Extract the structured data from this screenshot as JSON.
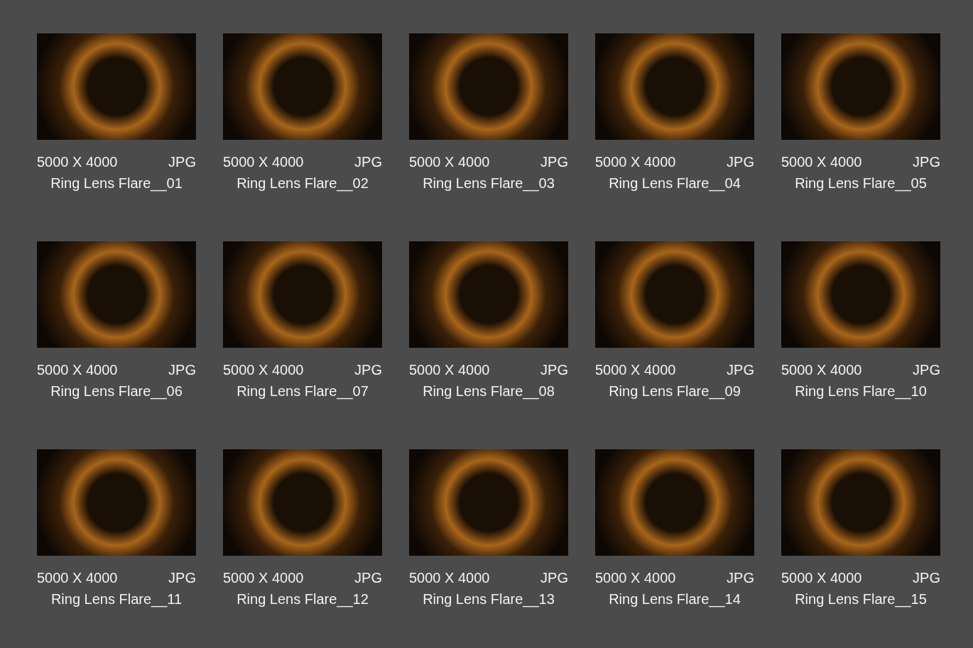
{
  "items": [
    {
      "size": "5000 X 4000",
      "format": "JPG",
      "name": "Ring Lens Flare__01"
    },
    {
      "size": "5000 X 4000",
      "format": "JPG",
      "name": "Ring Lens Flare__02"
    },
    {
      "size": "5000 X 4000",
      "format": "JPG",
      "name": "Ring Lens Flare__03"
    },
    {
      "size": "5000 X 4000",
      "format": "JPG",
      "name": "Ring Lens Flare__04"
    },
    {
      "size": "5000 X 4000",
      "format": "JPG",
      "name": "Ring Lens Flare__05"
    },
    {
      "size": "5000 X 4000",
      "format": "JPG",
      "name": "Ring Lens Flare__06"
    },
    {
      "size": "5000 X 4000",
      "format": "JPG",
      "name": "Ring Lens Flare__07"
    },
    {
      "size": "5000 X 4000",
      "format": "JPG",
      "name": "Ring Lens Flare__08"
    },
    {
      "size": "5000 X 4000",
      "format": "JPG",
      "name": "Ring Lens Flare__09"
    },
    {
      "size": "5000 X 4000",
      "format": "JPG",
      "name": "Ring Lens Flare__10"
    },
    {
      "size": "5000 X 4000",
      "format": "JPG",
      "name": "Ring Lens Flare__11"
    },
    {
      "size": "5000 X 4000",
      "format": "JPG",
      "name": "Ring Lens Flare__12"
    },
    {
      "size": "5000 X 4000",
      "format": "JPG",
      "name": "Ring Lens Flare__13"
    },
    {
      "size": "5000 X 4000",
      "format": "JPG",
      "name": "Ring Lens Flare__14"
    },
    {
      "size": "5000 X 4000",
      "format": "JPG",
      "name": "Ring Lens Flare__15"
    }
  ]
}
